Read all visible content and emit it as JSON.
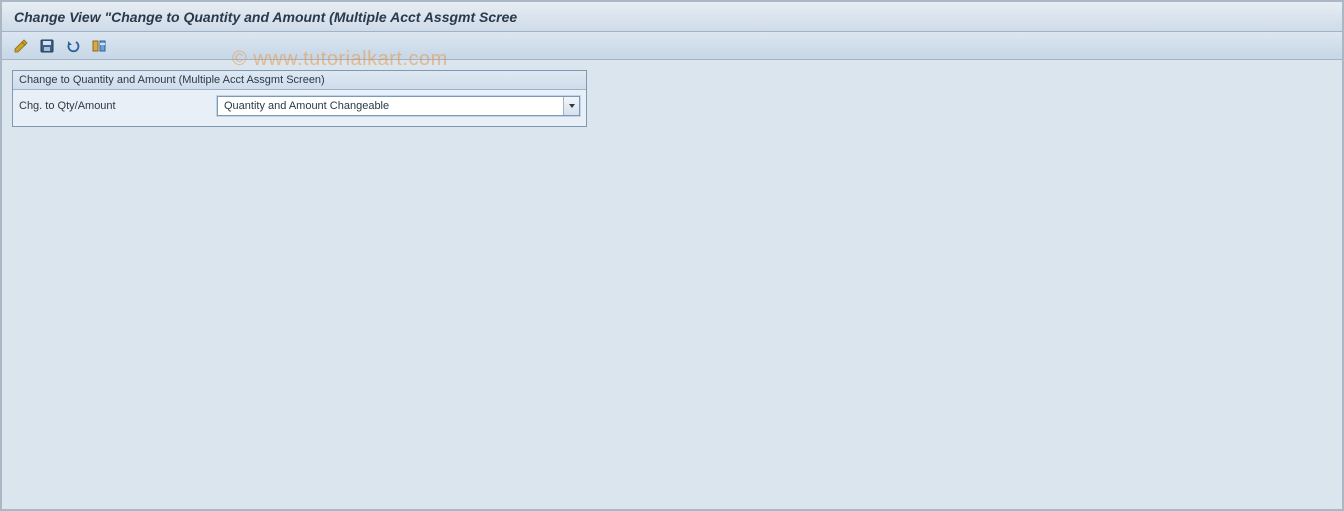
{
  "header": {
    "title": "Change View \"Change to Quantity and Amount (Multiple Acct Assgmt Scree"
  },
  "toolbar": {
    "buttons": [
      {
        "name": "change-mode-button",
        "icon": "pencil-icon"
      },
      {
        "name": "save-button",
        "icon": "save-icon"
      },
      {
        "name": "undo-button",
        "icon": "undo-icon"
      },
      {
        "name": "transport-button",
        "icon": "transport-icon"
      }
    ]
  },
  "panel": {
    "title": "Change to Quantity and Amount (Multiple Acct Assgmt Screen)",
    "field_label": "Chg. to Qty/Amount",
    "dropdown_value": "Quantity and Amount Changeable"
  },
  "watermark": "© www.tutorialkart.com"
}
